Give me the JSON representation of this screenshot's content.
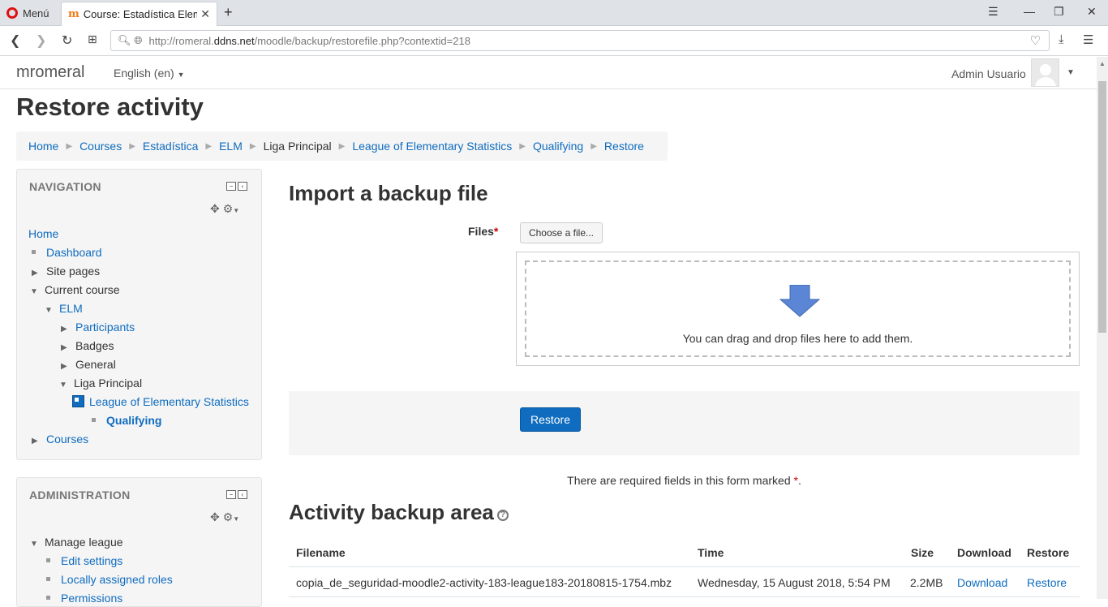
{
  "browser": {
    "menu_label": "Menú",
    "tab_title": "Course: Estadística Elemental",
    "tab_favicon": "m",
    "url_prefix": "http://romeral.",
    "url_host": "ddns.net",
    "url_path": "/moodle/backup/restorefile.php?contextid=218"
  },
  "navbar": {
    "brand": "mromeral",
    "language": "English (en)",
    "user_name": "Admin Usuario"
  },
  "page": {
    "title": "Restore activity",
    "breadcrumb": [
      "Home",
      "Courses",
      "Estadística",
      "ELM",
      "Liga Principal",
      "League of Elementary Statistics",
      "Qualifying",
      "Restore"
    ]
  },
  "navigation_block": {
    "title": "NAVIGATION",
    "items": {
      "home": "Home",
      "dashboard": "Dashboard",
      "site_pages": "Site pages",
      "current_course": "Current course",
      "elm": "ELM",
      "participants": "Participants",
      "badges": "Badges",
      "general": "General",
      "liga_principal": "Liga Principal",
      "league": "League of Elementary Statistics",
      "qualifying": "Qualifying",
      "courses": "Courses"
    }
  },
  "administration_block": {
    "title": "ADMINISTRATION",
    "items": {
      "manage_league": "Manage league",
      "edit_settings": "Edit settings",
      "locally_assigned_roles": "Locally assigned roles",
      "permissions": "Permissions"
    }
  },
  "import": {
    "heading": "Import a backup file",
    "files_label": "Files",
    "required_mark": "*",
    "choose_button": "Choose a file...",
    "drop_text": "You can drag and drop files here to add them.",
    "restore_button": "Restore",
    "required_note": "There are required fields in this form marked",
    "required_note_end": "."
  },
  "backup_area": {
    "heading": "Activity backup area",
    "columns": [
      "Filename",
      "Time",
      "Size",
      "Download",
      "Restore"
    ],
    "rows": [
      {
        "filename": "copia_de_seguridad-moodle2-activity-183-league183-20180815-1754.mbz",
        "time": "Wednesday, 15 August 2018, 5:54 PM",
        "size": "2.2MB",
        "download": "Download",
        "restore": "Restore"
      }
    ]
  },
  "colors": {
    "link": "#0f6cbf",
    "primary_button": "#0f6cbf",
    "required": "#cc0000"
  }
}
